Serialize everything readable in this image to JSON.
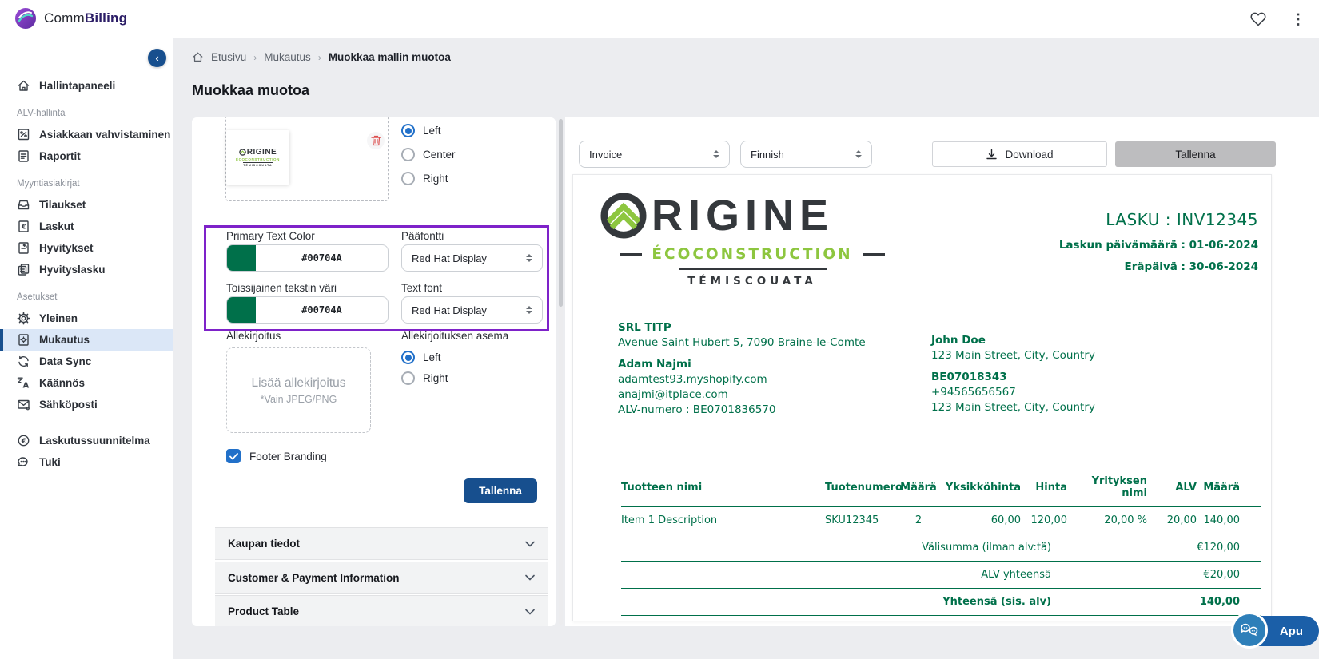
{
  "colors": {
    "accent_green": "#00704A",
    "primary_blue": "#174f8e",
    "control_blue": "#2170c9",
    "highlight_purple": "#7e22c9",
    "logo_green": "#8dc63f",
    "logo_dark": "#34383c"
  },
  "topbar": {
    "brand_prefix": "Comm",
    "brand_suffix": "Billing"
  },
  "sidebar": {
    "dashboard": {
      "label": "Hallintapaneeli"
    },
    "sections": [
      {
        "label": "ALV-hallinta",
        "items": [
          {
            "label": "Asiakkaan vahvistaminen"
          },
          {
            "label": "Raportit"
          }
        ]
      },
      {
        "label": "Myyntiasiakirjat",
        "items": [
          {
            "label": "Tilaukset"
          },
          {
            "label": "Laskut"
          },
          {
            "label": "Hyvitykset"
          },
          {
            "label": "Hyvityslasku"
          }
        ]
      },
      {
        "label": "Asetukset",
        "items": [
          {
            "label": "Yleinen"
          },
          {
            "label": "Mukautus",
            "active": true
          },
          {
            "label": "Data Sync"
          },
          {
            "label": "Käännös"
          },
          {
            "label": "Sähköposti"
          }
        ]
      }
    ],
    "footer_items": [
      {
        "label": "Laskutussuunnitelma"
      },
      {
        "label": "Tuki"
      }
    ]
  },
  "breadcrumb": {
    "home": "Etusivu",
    "section": "Mukautus",
    "current": "Muokkaa mallin muotoa"
  },
  "page_title": "Muokkaa muotoa",
  "editor": {
    "logo_align": {
      "options": [
        "Left",
        "Center",
        "Right"
      ],
      "selected": "Left"
    },
    "primary_color_label": "Primary Text Color",
    "primary_color_value": "#00704A",
    "heading_font_label": "Pääfontti",
    "heading_font_value": "Red Hat Display",
    "secondary_color_label": "Toissijainen tekstin väri",
    "secondary_color_value": "#00704A",
    "text_font_label": "Text font",
    "text_font_value": "Red Hat Display",
    "signature_label": "Allekirjoitus",
    "signature_dropzone_title": "Lisää allekirjoitus",
    "signature_dropzone_note": "*Vain JPEG/PNG",
    "signature_position_label": "Allekirjoituksen asema",
    "signature_position": {
      "options": [
        "Left",
        "Right"
      ],
      "selected": "Left"
    },
    "footer_branding_label": "Footer Branding",
    "save_label": "Tallenna",
    "accordions": [
      {
        "label": "Kaupan tiedot"
      },
      {
        "label": "Customer & Payment Information"
      },
      {
        "label": "Product Table"
      }
    ]
  },
  "preview_toolbar": {
    "doc_type": "Invoice",
    "language": "Finnish",
    "download_label": "Download",
    "save_label": "Tallenna"
  },
  "invoice": {
    "brand": {
      "name": "ORIGINE",
      "name_rest": "RIGINE",
      "subtitle": "ÉCOCONSTRUCTION",
      "region": "TÉMISCOUATA"
    },
    "number": "LASKU : INV12345",
    "date": "Laskun päivämäärä : 01-06-2024",
    "due": "Eräpäivä : 30-06-2024",
    "seller": {
      "company": "SRL TITP",
      "address": "Avenue Saint Hubert 5, 7090 Braine-le-Comte",
      "contact_name": "Adam Najmi",
      "website": "adamtest93.myshopify.com",
      "email": "anajmi@itplace.com",
      "vat_line": "ALV-numero : BE0701836570"
    },
    "buyer": {
      "name": "John Doe",
      "address": "123 Main Street, City, Country",
      "vat": "BE07018343",
      "phone": "+94565656567",
      "address2": "123 Main Street, City, Country"
    },
    "table": {
      "headers": [
        "Tuotteen nimi",
        "Tuotenumero",
        "Määrä",
        "Yksikköhinta",
        "Hinta",
        "Yrityksen nimi",
        "ALV",
        "Määrä"
      ],
      "rows": [
        [
          "Item 1 Description",
          "SKU12345",
          "2",
          "60,00",
          "120,00",
          "20,00 %",
          "20,00",
          "140,00"
        ]
      ]
    },
    "totals": [
      {
        "label": "Välisumma (ilman alv:tä)",
        "value": "€120,00"
      },
      {
        "label": "ALV yhteensä",
        "value": "€20,00"
      },
      {
        "label": "Yhteensä (sis. alv)",
        "value": "140,00"
      }
    ]
  },
  "help": {
    "label": "Apu"
  }
}
